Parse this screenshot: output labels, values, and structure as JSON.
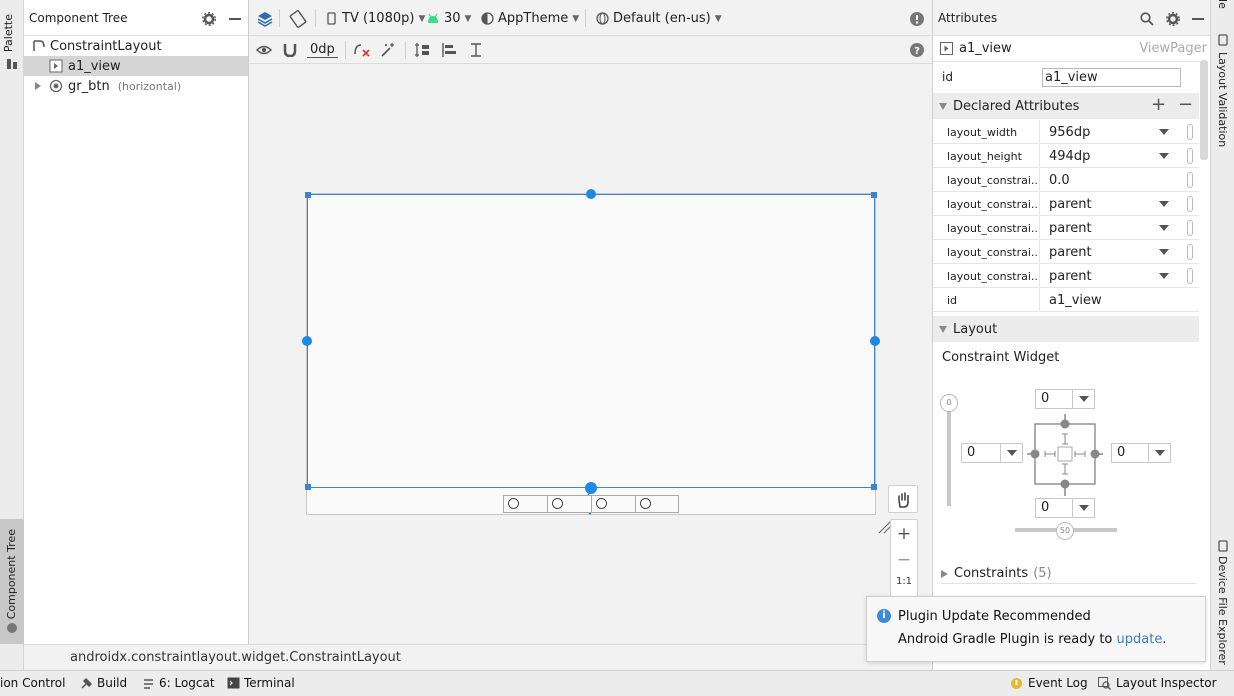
{
  "left_strip": {
    "palette_label": "Palette",
    "component_tree_label": "Component Tree"
  },
  "component_tree": {
    "title": "Component Tree",
    "items": [
      {
        "label": "ConstraintLayout",
        "sub": ""
      },
      {
        "label": "a1_view",
        "sub": ""
      },
      {
        "label": "gr_btn",
        "sub": "(horizontal)"
      }
    ]
  },
  "toolbar": {
    "device": "TV (1080p)",
    "api_level": "30",
    "theme": "AppTheme",
    "locale": "Default (en-us)",
    "default_margin": "0dp"
  },
  "canvas": {
    "zoom_fit_label": "1:1"
  },
  "attributes": {
    "title": "Attributes",
    "selected_name": "a1_view",
    "selected_class": "ViewPager",
    "id_label": "id",
    "id_value": "a1_view",
    "declared_header": "Declared Attributes",
    "declared": [
      {
        "key": "layout_width",
        "value": "956dp",
        "dropdown": true
      },
      {
        "key": "layout_height",
        "value": "494dp",
        "dropdown": true
      },
      {
        "key": "layout_constrai...",
        "value": "0.0",
        "dropdown": false
      },
      {
        "key": "layout_constrai...",
        "value": "parent",
        "dropdown": true
      },
      {
        "key": "layout_constrai...",
        "value": "parent",
        "dropdown": true
      },
      {
        "key": "layout_constrai...",
        "value": "parent",
        "dropdown": true
      },
      {
        "key": "layout_constrai...",
        "value": "parent",
        "dropdown": true
      },
      {
        "key": "id",
        "value": "a1_view",
        "dropdown": false
      }
    ],
    "layout_header": "Layout",
    "constraint_widget_label": "Constraint Widget",
    "margins": {
      "top": "0",
      "left": "0",
      "right": "0",
      "bottom": "0"
    },
    "vertical_bias": "0",
    "horizontal_bias": "50",
    "constraints_label": "Constraints",
    "constraints_count": "(5)"
  },
  "right_strip": {
    "top_label": "ile",
    "layout_validation": "Layout Validation",
    "device_file_explorer": "Device File Explorer"
  },
  "status_path": "androidx.constraintlayout.widget.ConstraintLayout",
  "bottom_bar": {
    "version_control": "ion Control",
    "build": "Build",
    "logcat": "6: Logcat",
    "terminal": "Terminal",
    "event_log": "Event Log",
    "layout_inspector": "Layout Inspector"
  },
  "notification": {
    "title": "Plugin Update Recommended",
    "body": "Android Gradle Plugin is ready to",
    "link": "update",
    "tail": "."
  },
  "colors": {
    "accent": "#1e88e5",
    "selection": "#3c82d6",
    "link": "#3d7ac8",
    "android_green": "#3ddc84"
  }
}
